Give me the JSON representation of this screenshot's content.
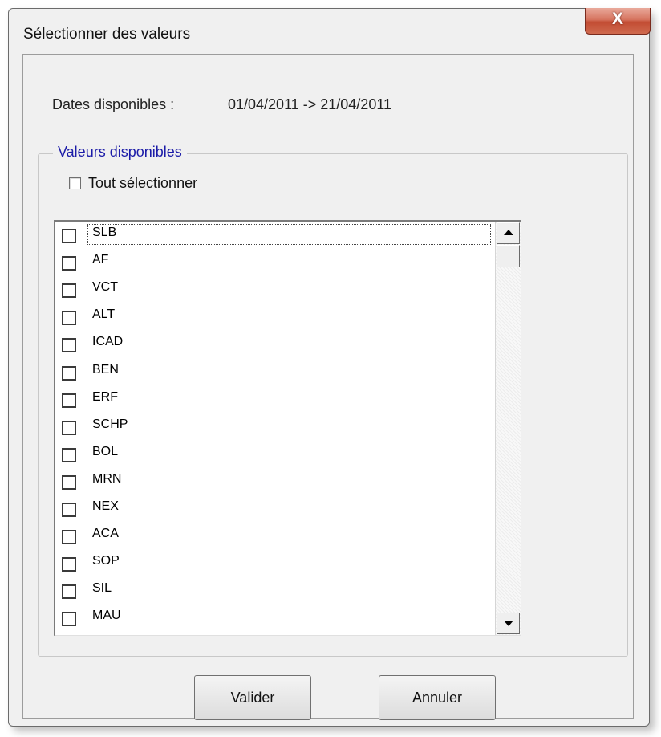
{
  "window": {
    "title": "Sélectionner des valeurs",
    "close_glyph": "X"
  },
  "dates": {
    "label": "Dates disponibles :",
    "value": "01/04/2011 -> 21/04/2011"
  },
  "group": {
    "legend": "Valeurs disponibles",
    "select_all_label": "Tout sélectionner",
    "items": [
      "SLB",
      "AF",
      "VCT",
      "ALT",
      "ICAD",
      "BEN",
      "ERF",
      "SCHP",
      "BOL",
      "MRN",
      "NEX",
      "ACA",
      "SOP",
      "SIL",
      "MAU"
    ]
  },
  "buttons": {
    "ok_label": "Valider",
    "cancel_label": "Annuler"
  },
  "colors": {
    "legend_text": "#1c1ca8",
    "close_button": "#c24c33"
  },
  "icons": [
    "close-icon",
    "scroll-up-arrow-icon",
    "scroll-down-arrow-icon"
  ]
}
